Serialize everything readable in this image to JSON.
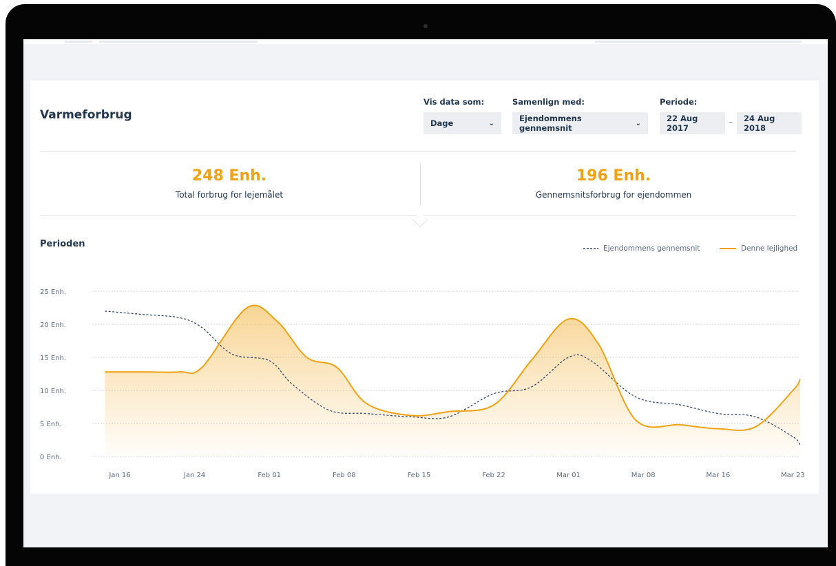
{
  "header": {
    "title": "Varmeforbrug",
    "display_label": "Vis data som:",
    "display_value": "Dage",
    "compare_label": "Samenlign med:",
    "compare_value": "Ejendommens gennemsnit",
    "period_label": "Periode:",
    "period_from": "22 Aug 2017",
    "period_separator": "–",
    "period_to": "24 Aug 2018"
  },
  "icons": {
    "display_chevron": "chevron-down-icon",
    "compare_chevron": "chevron-down-icon"
  },
  "chevron_glyph": "⌄",
  "stats": [
    {
      "value": "248 Enh.",
      "label": "Total forbrug for lejemålet"
    },
    {
      "value": "196 Enh.",
      "label": "Gennemsnitsforbrug for ejendommen"
    }
  ],
  "colors": {
    "accent": "#f0a214",
    "navy": "#22374f",
    "average_line": "#34466a",
    "grid": "#c9ced6"
  },
  "chart_data": {
    "type": "line",
    "title": "Perioden",
    "ylim": [
      0,
      25
    ],
    "y_ticks": [
      0,
      5,
      10,
      15,
      20,
      25
    ],
    "y_tick_labels": [
      "0 Enh.",
      "5 Enh.",
      "10 Enh.",
      "15 Enh.",
      "20 Enh.",
      "25 Enh."
    ],
    "categories": [
      "Jan 16",
      "Jan 24",
      "Feb 01",
      "Feb 08",
      "Feb 15",
      "Feb 22",
      "Mar 01",
      "Mar 08",
      "Mar 16",
      "Mar 23"
    ],
    "grid": true,
    "legend_position": "top-right",
    "series": [
      {
        "name": "Ejendommens gennemsnit",
        "style": "dashed",
        "color": "#34466a",
        "x": [
          -0.2,
          0.3,
          0.8,
          1.1,
          1.5,
          2.0,
          2.3,
          2.8,
          3.3,
          3.9,
          4.4,
          5.0,
          5.5,
          6.0,
          6.3,
          6.9,
          7.5,
          8.0,
          8.5,
          9.0,
          9.5
        ],
        "values": [
          22,
          21.5,
          21,
          19.5,
          15.5,
          14.5,
          11,
          7,
          6.5,
          6,
          6,
          9.5,
          10.5,
          15,
          14.5,
          9,
          7.8,
          6.5,
          6,
          3,
          1.7
        ]
      },
      {
        "name": "Denne lejlighed",
        "style": "solid",
        "color": "#f0a214",
        "fill": true,
        "x": [
          -0.2,
          0.3,
          0.8,
          1.1,
          1.7,
          2.1,
          2.5,
          2.9,
          3.3,
          3.9,
          4.4,
          5.0,
          5.5,
          6.0,
          6.4,
          6.9,
          7.5,
          8.0,
          8.5,
          9.0,
          9.5
        ],
        "values": [
          12.8,
          12.8,
          12.8,
          13.5,
          22.5,
          20.5,
          15,
          13.5,
          8,
          6.2,
          6.8,
          7.8,
          14.5,
          20.8,
          17,
          5.5,
          4.8,
          4.2,
          4.5,
          10,
          11.7
        ]
      }
    ]
  }
}
